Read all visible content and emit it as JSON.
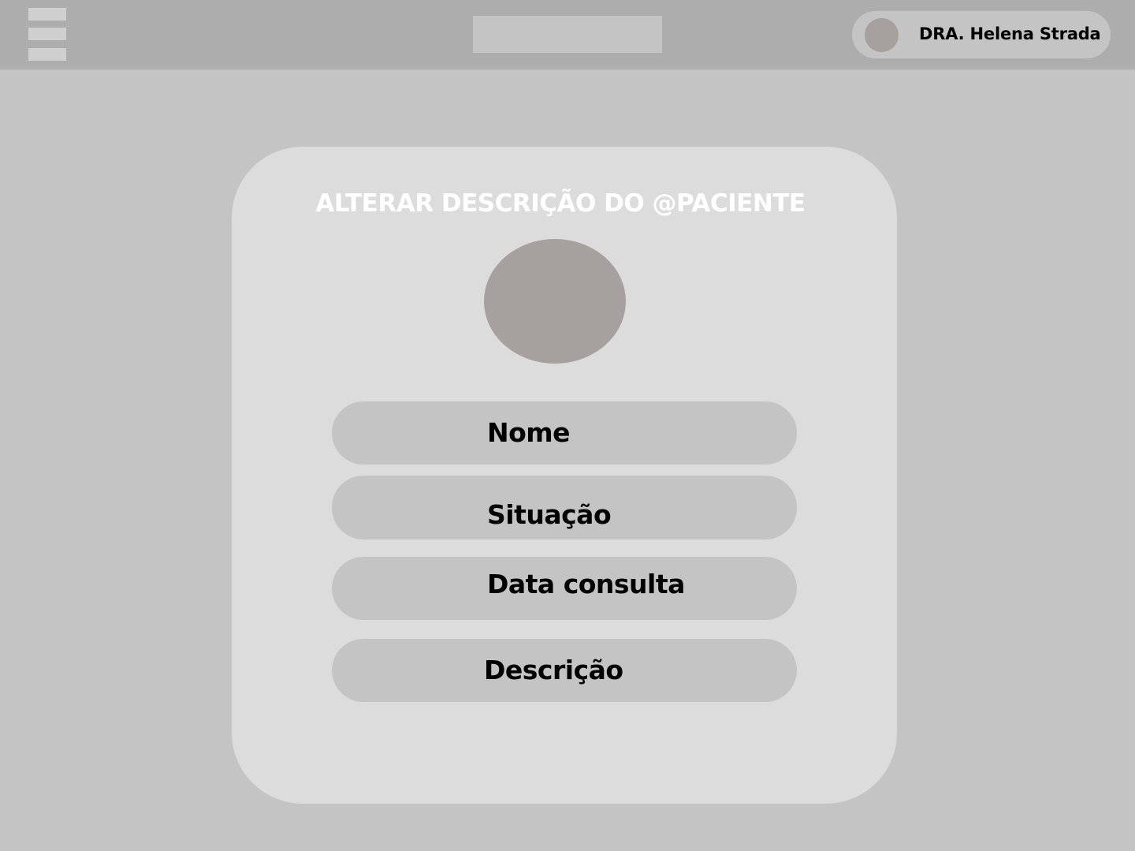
{
  "header": {
    "menu_icon": "hamburger-menu-icon",
    "user": {
      "name": "DRA. Helena Strada",
      "avatar_icon": "user-avatar-placeholder"
    }
  },
  "card": {
    "title": "ALTERAR DESCRIÇÃO DO @PACIENTE",
    "avatar_icon": "patient-avatar-placeholder",
    "fields": [
      {
        "placeholder": "Nome"
      },
      {
        "placeholder": "Situação"
      },
      {
        "placeholder": "Data consulta"
      },
      {
        "placeholder": "Descrição"
      }
    ]
  },
  "colors": {
    "background": "#c4c4c4",
    "topbar": "#adadad",
    "card": "#dcdcdc",
    "field": "#c4c4c4",
    "avatar": "#a6a09e",
    "title_text": "#ffffff"
  }
}
